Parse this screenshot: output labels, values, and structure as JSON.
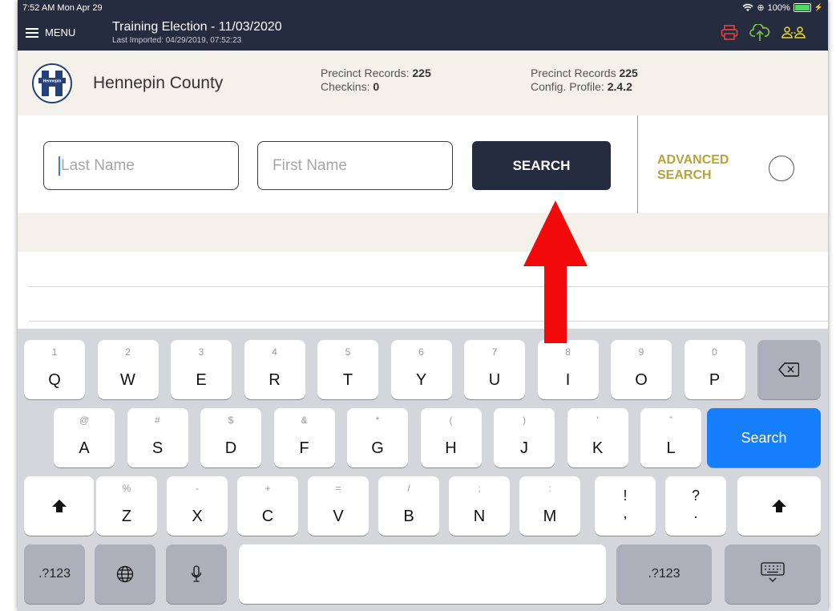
{
  "status_bar": {
    "time": "7:52 AM  Mon Apr 29",
    "battery": "100%"
  },
  "header": {
    "menu_label": "MENU",
    "election_title": "Training Election - 11/03/2020",
    "last_imported": "Last Imported: 04/29/2019, 07:52:23"
  },
  "county": {
    "name": "Hennepin County",
    "logo_text": "Hennepin",
    "precinct_label_1": "Precinct Records:",
    "precinct_value_1": "225",
    "checkins_label": "Checkins:",
    "checkins_value": "0",
    "precinct_label_2": "Precinct Records",
    "precinct_value_2": "225",
    "config_label": "Config. Profile:",
    "config_value": "2.4.2"
  },
  "search": {
    "last_name_placeholder": "Last Name",
    "first_name_placeholder": "First Name",
    "button_label": "SEARCH",
    "advanced_line1": "ADVANCED",
    "advanced_line2": "SEARCH"
  },
  "keyboard": {
    "row1": [
      {
        "hint": "1",
        "key": "Q"
      },
      {
        "hint": "2",
        "key": "W"
      },
      {
        "hint": "3",
        "key": "E"
      },
      {
        "hint": "4",
        "key": "R"
      },
      {
        "hint": "5",
        "key": "T"
      },
      {
        "hint": "6",
        "key": "Y"
      },
      {
        "hint": "7",
        "key": "U"
      },
      {
        "hint": "8",
        "key": "I"
      },
      {
        "hint": "9",
        "key": "O"
      },
      {
        "hint": "0",
        "key": "P"
      }
    ],
    "row2": [
      {
        "hint": "@",
        "key": "A"
      },
      {
        "hint": "#",
        "key": "S"
      },
      {
        "hint": "$",
        "key": "D"
      },
      {
        "hint": "&",
        "key": "F"
      },
      {
        "hint": "*",
        "key": "G"
      },
      {
        "hint": "(",
        "key": "H"
      },
      {
        "hint": ")",
        "key": "J"
      },
      {
        "hint": "’",
        "key": "K"
      },
      {
        "hint": "”",
        "key": "L"
      }
    ],
    "row3": [
      {
        "hint": "%",
        "key": "Z"
      },
      {
        "hint": "-",
        "key": "X"
      },
      {
        "hint": "+",
        "key": "C"
      },
      {
        "hint": "=",
        "key": "V"
      },
      {
        "hint": "/",
        "key": "B"
      },
      {
        "hint": ";",
        "key": "N"
      },
      {
        "hint": ":",
        "key": "M"
      }
    ],
    "punct1_top": "!",
    "punct1_bottom": ",",
    "punct2_top": "?",
    "punct2_bottom": ".",
    "search_key": "Search",
    "numbers_key": ".?123"
  }
}
